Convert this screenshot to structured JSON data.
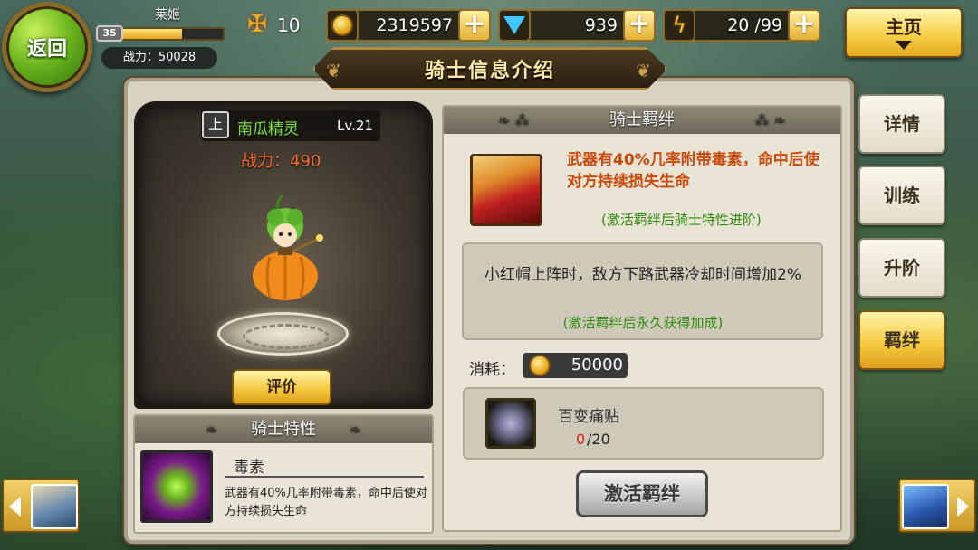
{
  "top_bar": {
    "back_label": "返回",
    "player_name": "莱姬",
    "player_level": "35",
    "exp_fraction": 0.6,
    "power_text": "战力：50028",
    "rank_icon": "winged-shield-icon",
    "rank_value": "10",
    "gold_value": "2319597",
    "diamond_value": "939",
    "stamina_value": "20 /99",
    "plus_symbol": "+",
    "home_label": "主页"
  },
  "title": "骑士信息介绍",
  "knight": {
    "rank_tag": "上",
    "name": "南瓜精灵",
    "level": "Lv.21",
    "power": "战力：490",
    "rate_label": "评价"
  },
  "trait": {
    "header": "骑士特性",
    "name": "毒素",
    "description": "武器有40%几率附带毒素，命中后使对方持续损失生命"
  },
  "bond": {
    "header": "骑士羁绊",
    "effect": "武器有40%几率附带毒素，命中后使对方持续损失生命",
    "effect_note": "(激活羁绊后骑士特性进阶)",
    "condition": "小红帽上阵时，敌方下路武器冷却时间增加2%",
    "condition_note": "(激活羁绊后永久获得加成)",
    "cost_label": "消耗：",
    "cost_value": "50000",
    "item_name": "百变痛贴",
    "item_have": "0",
    "item_need": "/20",
    "activate_label": "激活羁绊"
  },
  "side_tabs": [
    {
      "label": "详情",
      "active": false
    },
    {
      "label": "训练",
      "active": false
    },
    {
      "label": "升阶",
      "active": false
    },
    {
      "label": "羁绊",
      "active": true
    }
  ],
  "colors": {
    "accent_gold": "#f3c63a",
    "name_green": "#7ee03c",
    "power_orange": "#ff6a2a",
    "note_green": "#2e8a0c",
    "effect_orange": "#c94a0a",
    "count_red": "#d62a0a"
  }
}
